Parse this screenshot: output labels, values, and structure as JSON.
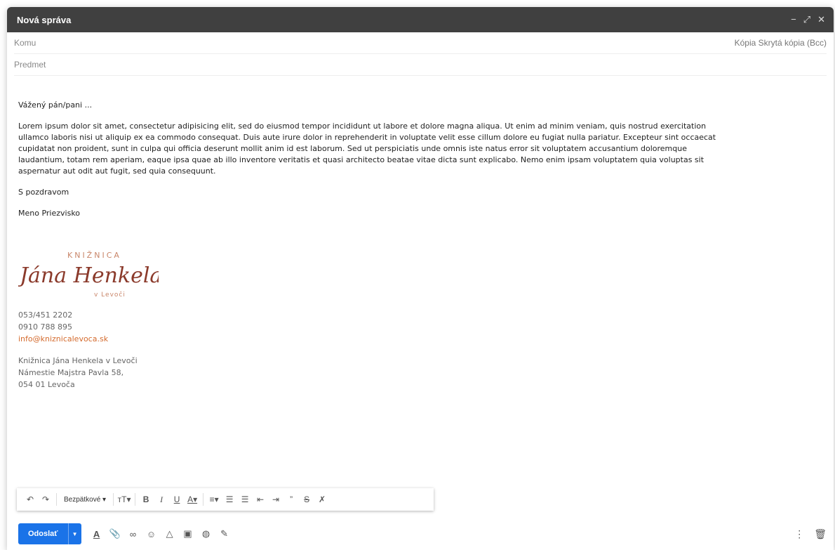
{
  "window": {
    "title": "Nová správa"
  },
  "fields": {
    "to_placeholder": "Komu",
    "cc_links": "Kópia Skrytá kópia (Bcc)",
    "subject_placeholder": "Predmet"
  },
  "body": {
    "greeting": "Vážený pán/pani ...",
    "paragraph": "Lorem ipsum dolor sit amet, consectetur adipisicing elit, sed do eiusmod tempor incididunt ut labore et dolore magna aliqua. Ut enim ad minim veniam, quis nostrud exercitation ullamco laboris nisi ut aliquip ex ea commodo consequat. Duis aute irure dolor in reprehenderit in voluptate velit esse cillum dolore eu fugiat nulla pariatur. Excepteur sint occaecat cupidatat non proident, sunt in culpa qui officia deserunt mollit anim id est laborum. Sed ut perspiciatis unde omnis iste natus error sit voluptatem accusantium doloremque laudantium, totam rem aperiam, eaque ipsa quae ab illo inventore veritatis et quasi architecto beatae vitae dicta sunt explicabo. Nemo enim ipsam voluptatem quia voluptas sit aspernatur aut odit aut fugit, sed quia consequunt.",
    "regards": "S pozdravom",
    "signature_name": "Meno Priezvisko"
  },
  "signature": {
    "logo_top": "KNIŽNICA",
    "logo_script": "Jána Henkela",
    "logo_bottom": "v Levoči",
    "phone1": "053/451 2202",
    "phone2": "0910 788 895",
    "email": "info@kniznicalevoca.sk",
    "org": "Knižnica Jána Henkela v Levoči",
    "street": "Námestie Majstra Pavla 58,",
    "city": "054 01 Levoča"
  },
  "toolbar": {
    "font": "Bezpätkové",
    "items": [
      "undo-icon",
      "redo-icon",
      "font-select",
      "text-size-icon",
      "bold-icon",
      "italic-icon",
      "underline-icon",
      "text-color-icon",
      "align-icon",
      "numbered-list-icon",
      "bulleted-list-icon",
      "indent-less-icon",
      "indent-more-icon",
      "quote-icon",
      "strikethrough-icon",
      "remove-formatting-icon"
    ]
  },
  "bottom": {
    "send_label": "Odoslať"
  },
  "colors": {
    "titlebar": "#404040",
    "send": "#1a73e8",
    "link": "#d46b2e",
    "logo": "#c9866a"
  }
}
